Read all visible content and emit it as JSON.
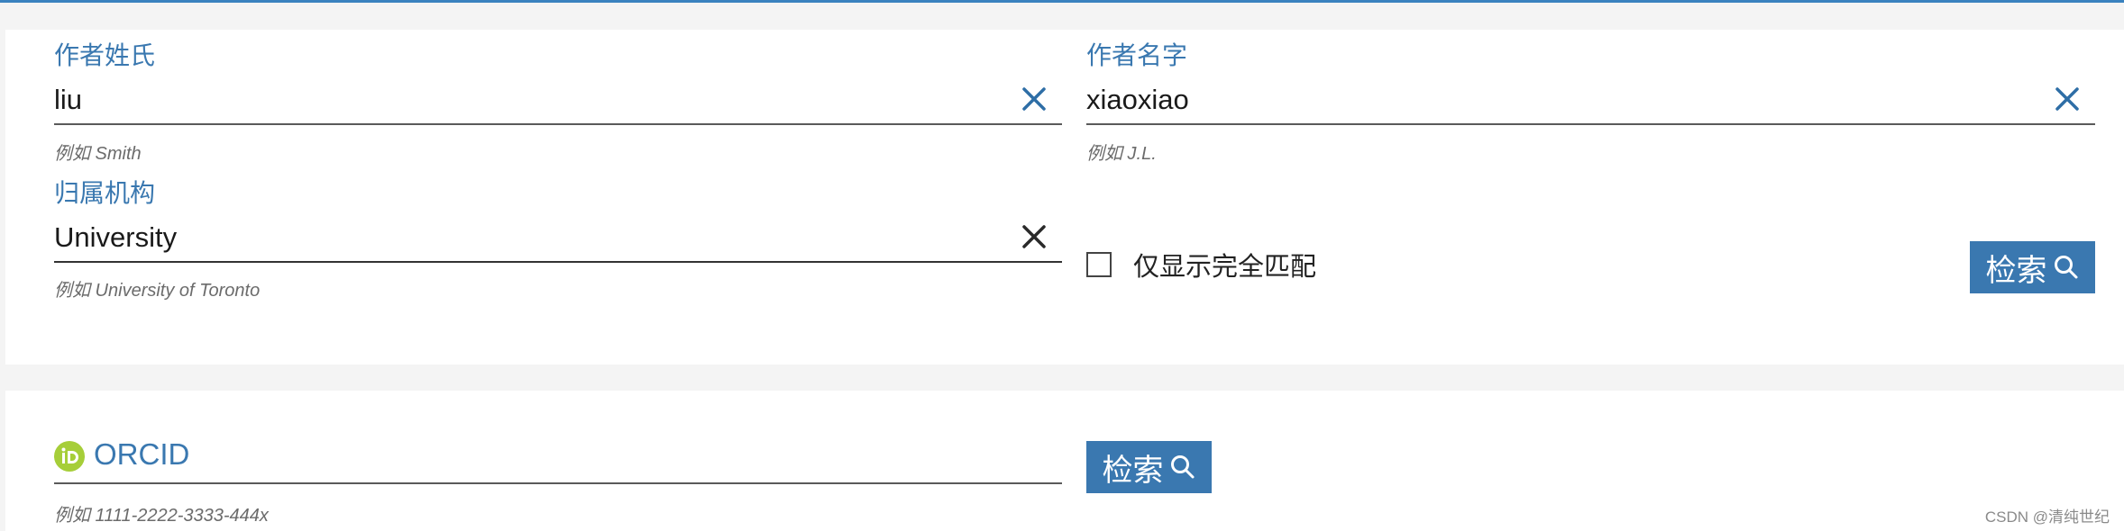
{
  "author_search": {
    "last_name": {
      "label": "作者姓氏",
      "value": "liu",
      "hint": "例如 Smith"
    },
    "first_name": {
      "label": "作者名字",
      "value": "xiaoxiao",
      "hint": "例如 J.L."
    },
    "affiliation": {
      "label": "归属机构",
      "value": "University",
      "hint": "例如 University of Toronto"
    },
    "exact_match_label": "仅显示完全匹配",
    "search_label": "检索"
  },
  "orcid_search": {
    "label": "ORCID",
    "value": "",
    "hint": "例如 1111-2222-3333-444x",
    "search_label": "检索"
  },
  "watermark": "CSDN @清纯世纪",
  "colors": {
    "accent": "#3a78b0",
    "orcid_green": "#a6ce39",
    "top_line": "#3a82bf"
  }
}
